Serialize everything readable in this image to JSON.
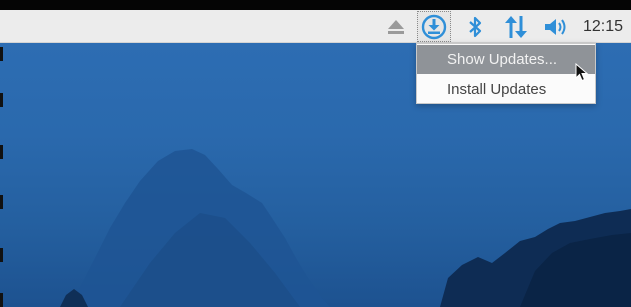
{
  "taskbar": {
    "tray_icons": [
      "eject-icon",
      "software-updates-icon",
      "bluetooth-icon",
      "network-transfer-icon",
      "volume-icon"
    ],
    "clock": "12:15"
  },
  "updates_menu": {
    "items": [
      {
        "label": "Show Updates...",
        "highlighted": true
      },
      {
        "label": "Install Updates",
        "highlighted": false
      }
    ]
  },
  "colors": {
    "taskbar_bg": "#ececec",
    "icon_blue": "#2f8fd8",
    "menu_highlight": "#8f9398",
    "desktop_bg": "#2a69ad"
  }
}
